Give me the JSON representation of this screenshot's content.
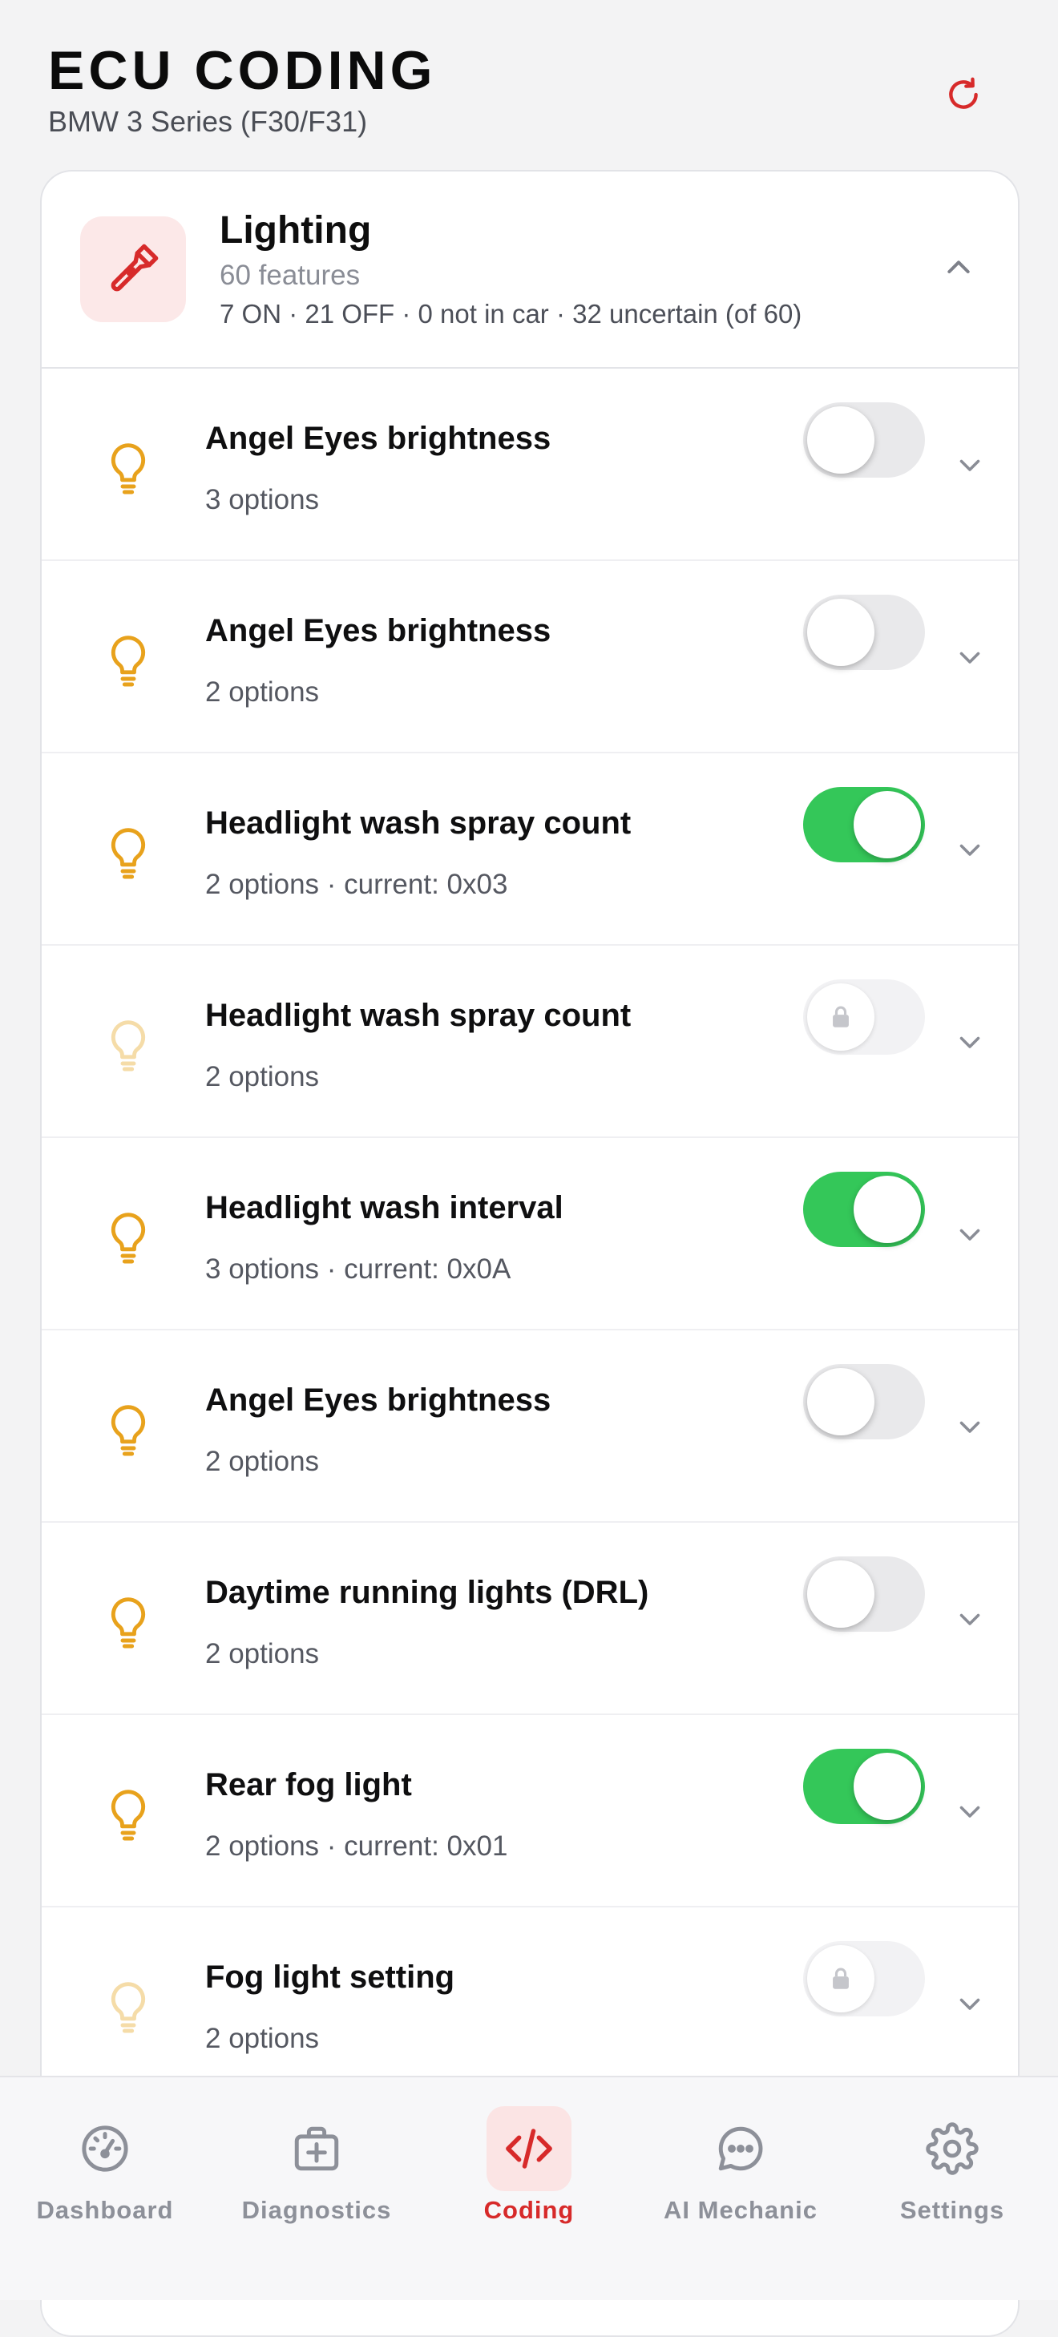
{
  "header": {
    "title": "ECU CODING",
    "subtitle": "BMW 3 Series (F30/F31)",
    "refresh_icon": "refresh-icon"
  },
  "category": {
    "title": "Lighting",
    "count": "60 features",
    "stats": "7 ON · 21 OFF · 0 not in car · 32 uncertain (of 60)",
    "icon": "flashlight-icon",
    "expanded": true
  },
  "features": [
    {
      "title": "Angel Eyes brightness",
      "sub": "3 options",
      "state": "off"
    },
    {
      "title": "Angel Eyes brightness",
      "sub": "2 options",
      "state": "off"
    },
    {
      "title": "Headlight wash spray count",
      "sub": "2 options · current: 0x03",
      "state": "on"
    },
    {
      "title": "Headlight wash spray count",
      "sub": "2 options",
      "state": "locked"
    },
    {
      "title": "Headlight wash interval",
      "sub": "3 options · current: 0x0A",
      "state": "on"
    },
    {
      "title": "Angel Eyes brightness",
      "sub": "2 options",
      "state": "off"
    },
    {
      "title": "Daytime running lights (DRL)",
      "sub": "2 options",
      "state": "off"
    },
    {
      "title": "Rear fog light",
      "sub": "2 options · current: 0x01",
      "state": "on"
    },
    {
      "title": "Fog light setting",
      "sub": "2 options",
      "state": "locked"
    }
  ],
  "tabs": [
    {
      "label": "Dashboard",
      "icon": "gauge-icon",
      "active": false
    },
    {
      "label": "Diagnostics",
      "icon": "medical-kit-icon",
      "active": false
    },
    {
      "label": "Coding",
      "icon": "code-icon",
      "active": true
    },
    {
      "label": "AI Mechanic",
      "icon": "chat-bubble-icon",
      "active": false
    },
    {
      "label": "Settings",
      "icon": "gear-icon",
      "active": false
    }
  ],
  "colors": {
    "accent": "#d72a2a",
    "toggle_on": "#34c759",
    "bulb": "#e8a21c",
    "bulb_dim": "#f5dca8"
  }
}
